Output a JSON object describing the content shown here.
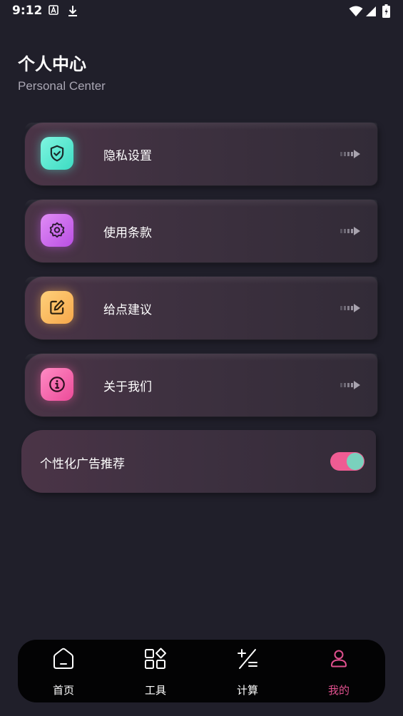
{
  "status_bar": {
    "time": "9:12",
    "icons": [
      "font-a-icon",
      "download-icon",
      "wifi-icon",
      "signal-icon",
      "battery-charging-icon"
    ]
  },
  "header": {
    "title": "个人中心",
    "subtitle": "Personal Center"
  },
  "menu": {
    "items": [
      {
        "label": "隐私设置",
        "icon": "shield-check-icon",
        "color": "#4fe8cf"
      },
      {
        "label": "使用条款",
        "icon": "gear-badge-icon",
        "color": "#cf6bee"
      },
      {
        "label": "给点建议",
        "icon": "edit-icon",
        "color": "#fbbd63"
      },
      {
        "label": "关于我们",
        "icon": "info-icon",
        "color": "#f564aa"
      }
    ]
  },
  "ad_setting": {
    "label": "个性化广告推荐",
    "enabled": true,
    "toggle_on_color": "#ef5c93"
  },
  "bottom_nav": {
    "items": [
      {
        "label": "首页",
        "icon": "home-icon",
        "active": false
      },
      {
        "label": "工具",
        "icon": "grid-icon",
        "active": false
      },
      {
        "label": "计算",
        "icon": "calculator-icon",
        "active": false
      },
      {
        "label": "我的",
        "icon": "user-icon",
        "active": true
      }
    ],
    "active_color": "#e0508e"
  }
}
